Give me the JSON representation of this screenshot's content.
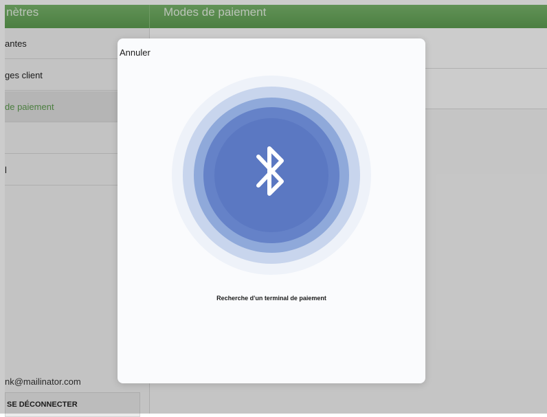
{
  "header": {
    "left_title": "nètres",
    "right_title": "Modes de paiement"
  },
  "sidebar": {
    "items": [
      {
        "label": "antes",
        "active": false
      },
      {
        "label": "ges client",
        "active": false
      },
      {
        "label": "de paiement",
        "active": true
      },
      {
        "label": "",
        "active": false
      },
      {
        "label": "l",
        "active": false
      }
    ],
    "user_email": "nk@mailinator.com",
    "logout_label": "SE DÉCONNECTER"
  },
  "modal": {
    "cancel_label": "Annuler",
    "status_text": "Recherche d'un terminal de paiement",
    "icon": "bluetooth-icon",
    "accent_color": "#5b78c2"
  },
  "colors": {
    "header_green": "#6aa95d",
    "active_item_green": "#5e9e4f"
  }
}
